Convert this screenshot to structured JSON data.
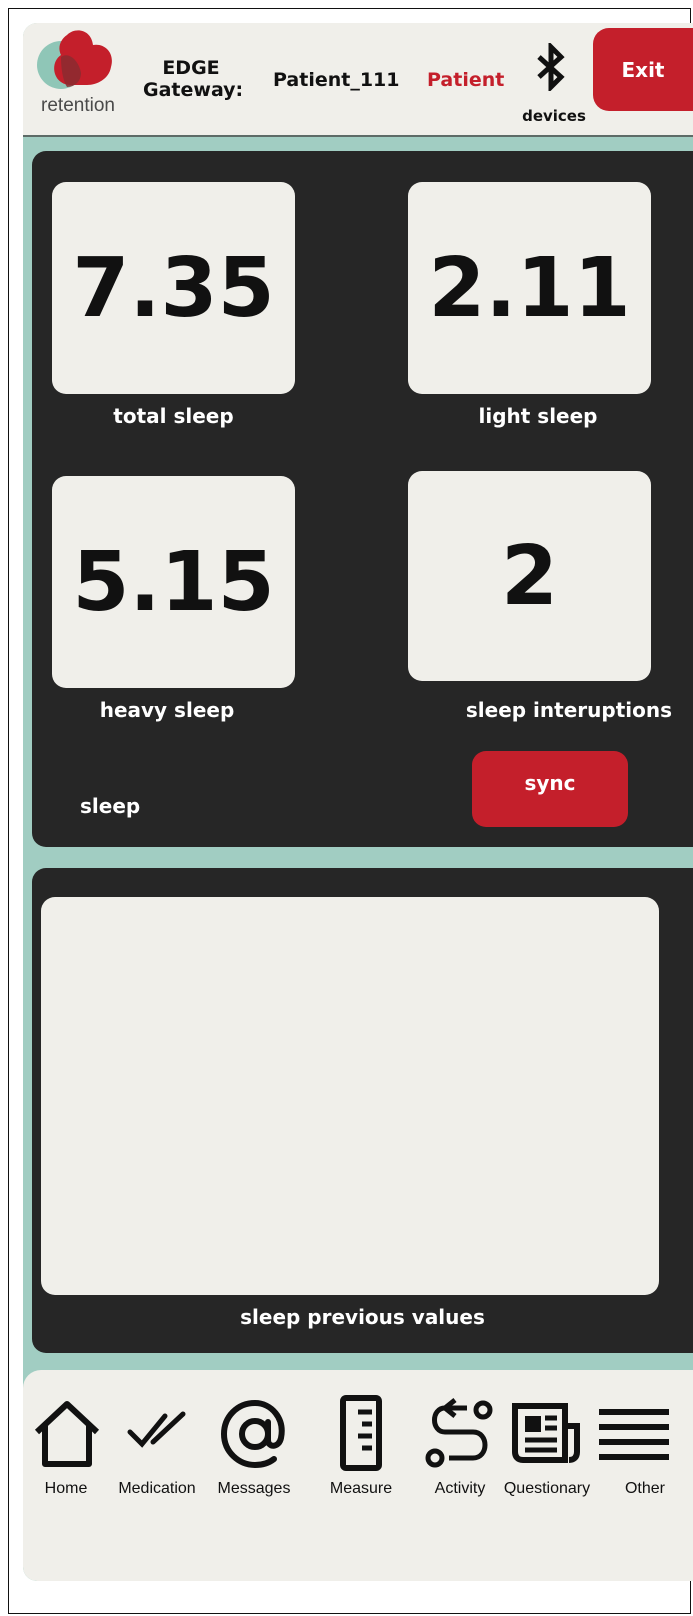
{
  "header": {
    "logo_text": "retention",
    "gateway_label": "EDGE Gateway:",
    "patient_id": "Patient_111",
    "role": "Patient",
    "devices_label": "devices",
    "exit_label": "Exit",
    "icons": [
      "retention-logo",
      "bluetooth-icon"
    ]
  },
  "sleep_panel": {
    "cards": [
      {
        "value": "7.35",
        "label": "total sleep"
      },
      {
        "value": "2.11",
        "label": "light sleep"
      },
      {
        "value": "5.15",
        "label": "heavy sleep"
      },
      {
        "value": "2",
        "label": "sleep interuptions"
      }
    ],
    "title": "sleep",
    "sync_label": "sync"
  },
  "previous_panel": {
    "caption": "sleep previous values"
  },
  "nav": {
    "items": [
      {
        "label": "Home",
        "icon": "home-icon"
      },
      {
        "label": "Medication",
        "icon": "double-check-icon"
      },
      {
        "label": "Messages",
        "icon": "at-sign-icon"
      },
      {
        "label": "Measure",
        "icon": "ruler-icon"
      },
      {
        "label": "Activity",
        "icon": "route-icon"
      },
      {
        "label": "Questionary",
        "icon": "newspaper-icon"
      },
      {
        "label": "Other",
        "icon": "menu-lines-icon"
      }
    ]
  },
  "colors": {
    "background": "#a1cdc2",
    "panel": "#262626",
    "card": "#f0efea",
    "accent_red": "#c41f2b"
  }
}
